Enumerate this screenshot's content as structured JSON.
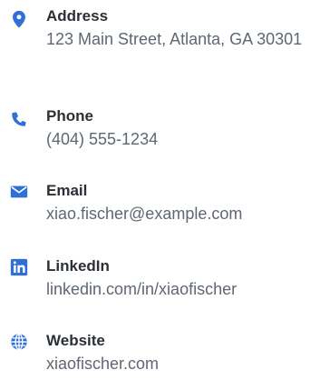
{
  "theme": {
    "accent_color": "#2f6fd6",
    "label_color": "#2b2f36",
    "value_color": "#5f6773"
  },
  "contacts": [
    {
      "icon": "map-pin-icon",
      "label": "Address",
      "value": "123 Main Street, Atlanta, GA 30301"
    },
    {
      "icon": "phone-icon",
      "label": "Phone",
      "value": "(404) 555-1234"
    },
    {
      "icon": "envelope-icon",
      "label": "Email",
      "value": "xiao.fischer@example.com"
    },
    {
      "icon": "linkedin-icon",
      "label": "LinkedIn",
      "value": "linkedin.com/in/xiaofischer"
    },
    {
      "icon": "globe-icon",
      "label": "Website",
      "value": "xiaofischer.com"
    }
  ]
}
